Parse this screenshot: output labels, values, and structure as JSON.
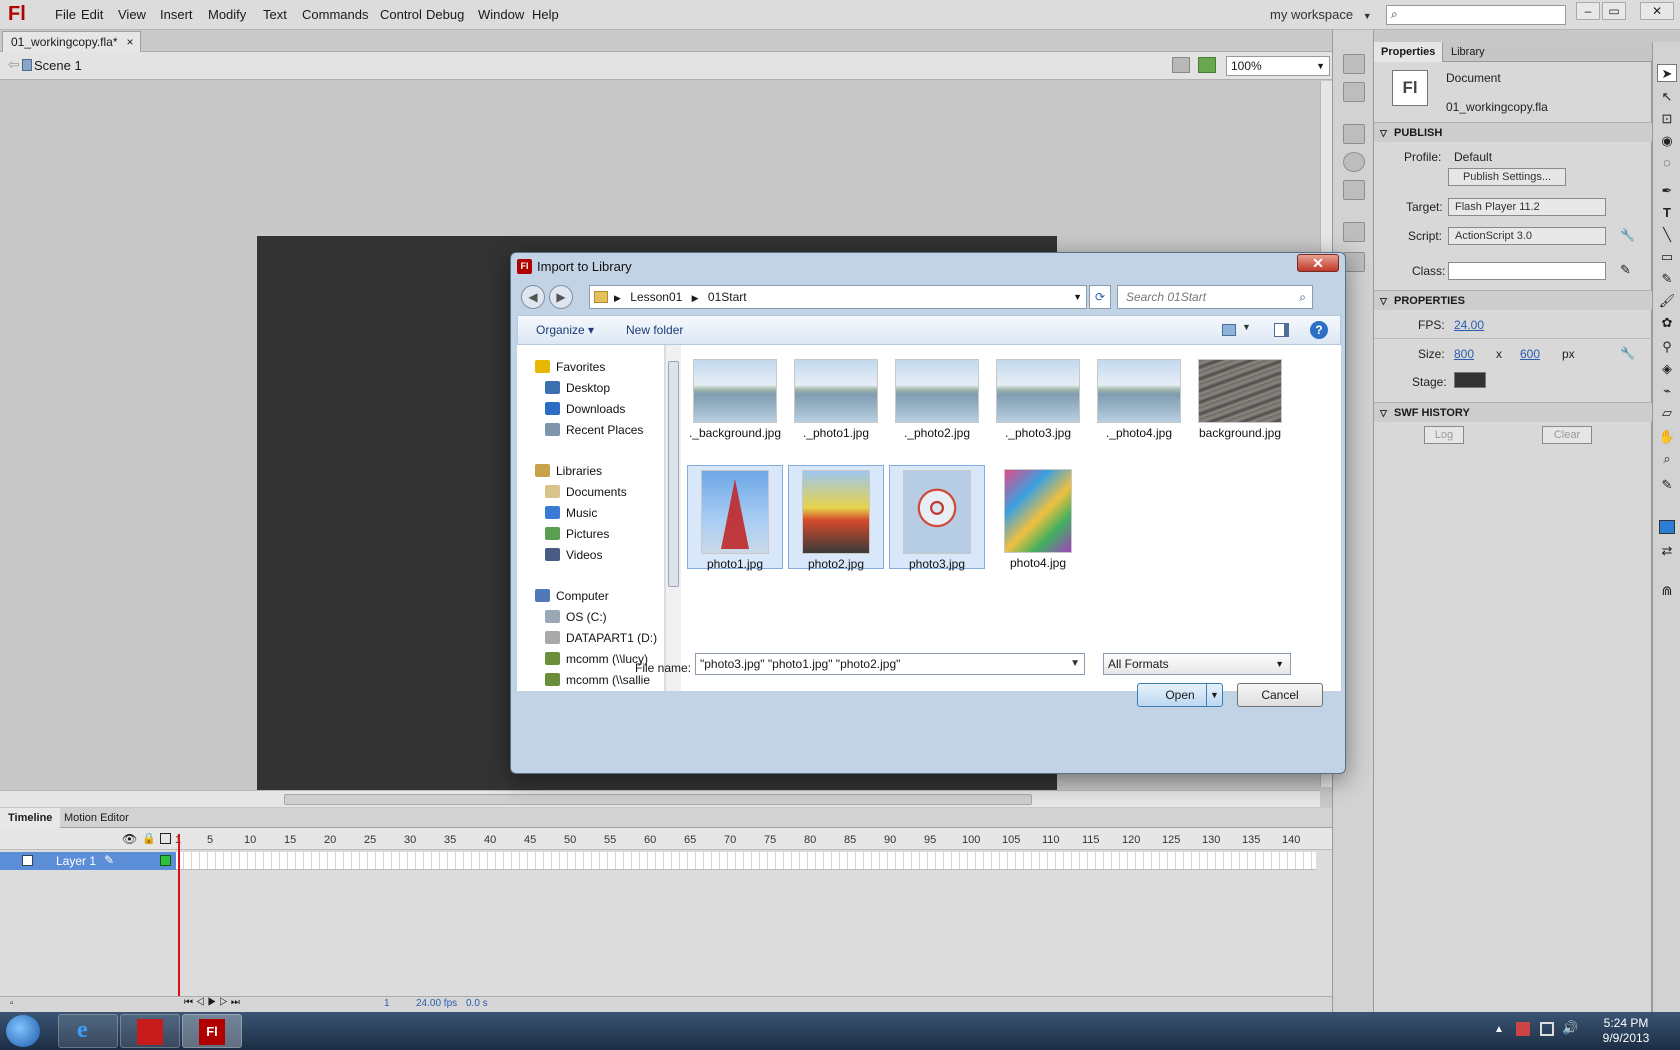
{
  "app": {
    "logo": "Fl",
    "menu": [
      "File",
      "Edit",
      "View",
      "Insert",
      "Modify",
      "Text",
      "Commands",
      "Control",
      "Debug",
      "Window",
      "Help"
    ],
    "workspace": "my workspace",
    "window_buttons": [
      "–",
      "▭",
      "✕"
    ]
  },
  "document": {
    "tab": "01_workingcopy.fla*",
    "tab_close": "×",
    "scene": "Scene 1",
    "zoom": "100%"
  },
  "timeline": {
    "tabs": [
      "Timeline",
      "Motion Editor"
    ],
    "frame_numbers": [
      "1",
      "5",
      "10",
      "15",
      "20",
      "25",
      "30",
      "35",
      "40",
      "45",
      "50",
      "55",
      "60",
      "65",
      "70",
      "75",
      "80",
      "85",
      "90",
      "95",
      "100",
      "105",
      "110",
      "115",
      "120",
      "125",
      "130",
      "135",
      "140"
    ],
    "layer": "Layer 1",
    "footer": {
      "frame": "1",
      "fps": "24.00 fps",
      "time": "0.0 s"
    }
  },
  "properties": {
    "tabs": [
      "Properties",
      "Library"
    ],
    "doc_icon": "Fl",
    "doc_type": "Document",
    "doc_name": "01_workingcopy.fla",
    "publish": {
      "heading": "PUBLISH",
      "profile_label": "Profile:",
      "profile": "Default",
      "settings_btn": "Publish Settings...",
      "target_label": "Target:",
      "target": "Flash Player 11.2",
      "script_label": "Script:",
      "script": "ActionScript 3.0",
      "class_label": "Class:"
    },
    "props": {
      "heading": "PROPERTIES",
      "fps_label": "FPS:",
      "fps": "24.00",
      "size_label": "Size:",
      "width": "800",
      "x": "x",
      "height": "600",
      "unit": "px",
      "stage_label": "Stage:",
      "stage_color": "#333333"
    },
    "swf": {
      "heading": "SWF HISTORY",
      "log": "Log",
      "clear": "Clear"
    }
  },
  "dialog": {
    "title": "Import to Library",
    "icon": "Fl",
    "close": "✕",
    "breadcrumb": [
      "Lesson01",
      "01Start"
    ],
    "search_placeholder": "Search 01Start",
    "organize": "Organize ▾",
    "new_folder": "New folder",
    "nav": [
      {
        "label": "Favorites",
        "icon": "star-icon",
        "color": "#e6b800",
        "group": true
      },
      {
        "label": "Desktop",
        "icon": "desktop-icon",
        "color": "#3b6fb0"
      },
      {
        "label": "Downloads",
        "icon": "downloads-icon",
        "color": "#2b6dc4"
      },
      {
        "label": "Recent Places",
        "icon": "recent-places-icon",
        "color": "#7f94ad"
      },
      {
        "label": "Libraries",
        "icon": "libraries-icon",
        "color": "#c8a24a",
        "group": true
      },
      {
        "label": "Documents",
        "icon": "documents-icon",
        "color": "#d8c38a"
      },
      {
        "label": "Music",
        "icon": "music-icon",
        "color": "#3a7bd5"
      },
      {
        "label": "Pictures",
        "icon": "pictures-icon",
        "color": "#5a9e52"
      },
      {
        "label": "Videos",
        "icon": "videos-icon",
        "color": "#4a5c86"
      },
      {
        "label": "Computer",
        "icon": "computer-icon",
        "color": "#4f79b6",
        "group": true
      },
      {
        "label": "OS (C:)",
        "icon": "drive-icon",
        "color": "#9aa7b6"
      },
      {
        "label": "DATAPART1 (D:)",
        "icon": "drive-icon",
        "color": "#a9a9a9"
      },
      {
        "label": "mcomm (\\\\lucy)",
        "icon": "network-drive-icon",
        "color": "#6b8e3a"
      },
      {
        "label": "mcomm (\\\\sallie",
        "icon": "network-drive-icon",
        "color": "#6b8e3a"
      }
    ],
    "files": [
      {
        "name": "._background.jpg",
        "kind": "sky",
        "selected": false
      },
      {
        "name": "._photo1.jpg",
        "kind": "sky",
        "selected": false
      },
      {
        "name": "._photo2.jpg",
        "kind": "sky",
        "selected": false
      },
      {
        "name": "._photo3.jpg",
        "kind": "sky",
        "selected": false
      },
      {
        "name": "._photo4.jpg",
        "kind": "sky",
        "selected": false
      },
      {
        "name": "background.jpg",
        "kind": "wood",
        "selected": false
      },
      {
        "name": "photo1.jpg",
        "kind": "tower",
        "selected": true
      },
      {
        "name": "photo2.jpg",
        "kind": "arcade",
        "selected": true
      },
      {
        "name": "photo3.jpg",
        "kind": "wheel",
        "selected": true
      },
      {
        "name": "photo4.jpg",
        "kind": "toys",
        "selected": false
      }
    ],
    "file_name_label": "File name:",
    "file_name": "\"photo3.jpg\" \"photo1.jpg\" \"photo2.jpg\"",
    "formats": "All Formats",
    "open": "Open",
    "cancel": "Cancel"
  },
  "taskbar": {
    "time": "5:24 PM",
    "date": "9/9/2013"
  }
}
